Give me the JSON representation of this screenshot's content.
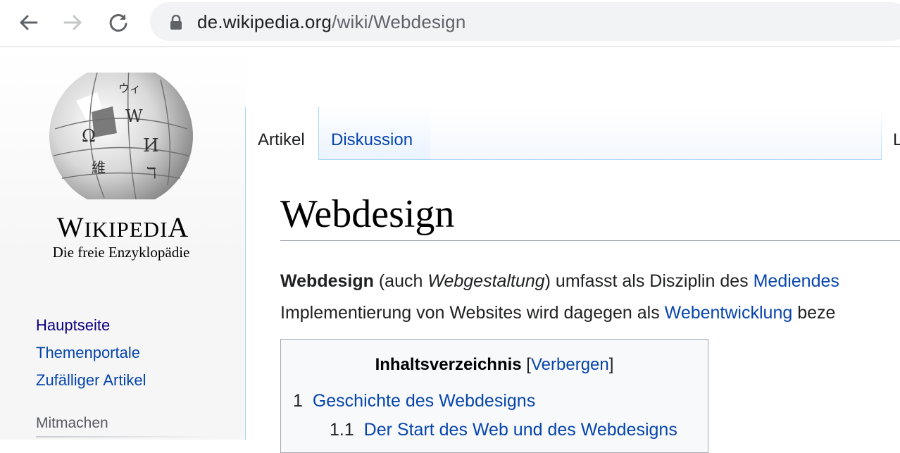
{
  "browser": {
    "url_host": "de.wikipedia.org",
    "url_path": "/wiki/Webdesign"
  },
  "sidebar": {
    "wordmark_first": "W",
    "wordmark_rest": "IKIPEDI",
    "wordmark_last": "A",
    "tagline": "Die freie Enzyklopädie",
    "nav_items": [
      {
        "label": "Hauptseite"
      },
      {
        "label": "Themenportale"
      },
      {
        "label": "Zufälliger Artikel"
      }
    ],
    "section_heading": "Mitmachen"
  },
  "tabs": [
    {
      "label": "Artikel",
      "selected": true
    },
    {
      "label": "Diskussion",
      "selected": false
    }
  ],
  "tab_cut_label": "L",
  "article": {
    "title": "Webdesign",
    "p1": {
      "bold": "Webdesign",
      "t1": " (auch ",
      "italic": "Webgestaltung",
      "t2": ") umfasst als Disziplin des ",
      "link": "Mediendes"
    },
    "p2": {
      "t1": "Implementierung von Websites wird dagegen als ",
      "link": "Webentwicklung",
      "t2": " beze"
    }
  },
  "toc": {
    "title": "Inhaltsverzeichnis",
    "open_bracket": " [",
    "toggle": "Verbergen",
    "close_bracket": "]",
    "items": [
      {
        "num": "1",
        "label": "Geschichte des Webdesigns"
      },
      {
        "num": "1.1",
        "label": "Der Start des Web und des Webdesigns"
      }
    ]
  },
  "colors": {
    "link": "#0645ad",
    "link_visited": "#0b0080",
    "tab_border": "#a7d7f9"
  }
}
